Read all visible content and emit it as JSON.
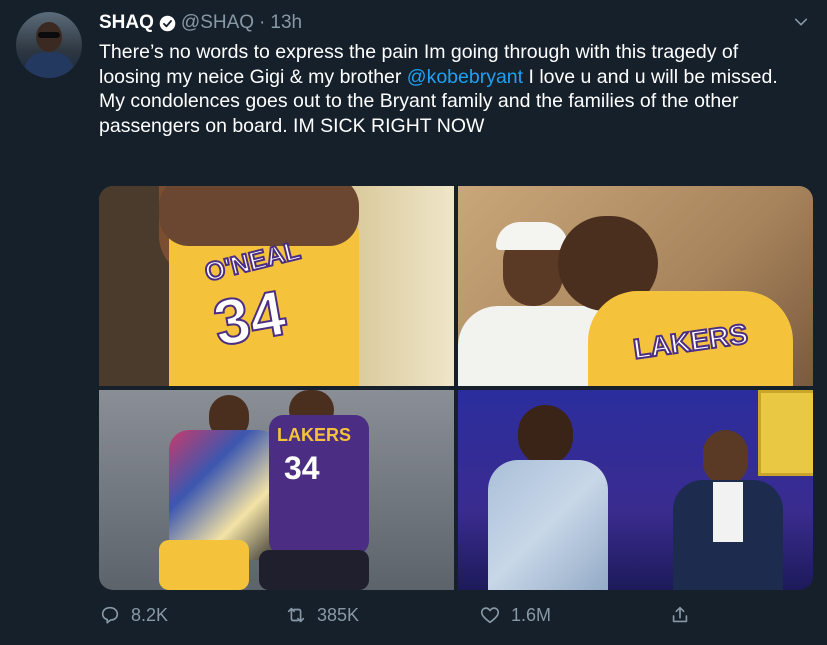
{
  "author": {
    "name": "SHAQ",
    "handle": "@SHAQ",
    "separator": "·",
    "time": "13h"
  },
  "tweet": {
    "text_before": "There’s no words to express the pain Im going through with this tragedy of loosing my neice Gigi & my brother ",
    "mention": "@kobebryant",
    "text_after": " I love u and u will be missed. My condolences goes out to the Bryant family and the families of the other passengers on board. IM SICK RIGHT NOW"
  },
  "media": {
    "photo1_jersey_name": "O'NEAL",
    "photo1_jersey_number": "34",
    "photo2_jersey_text": "LAKERS",
    "photo3_jersey_text": "LAKERS",
    "photo3_jersey_number": "34"
  },
  "actions": {
    "reply_count": "8.2K",
    "retweet_count": "385K",
    "like_count": "1.6M"
  },
  "colors": {
    "background": "#15202b",
    "secondary_text": "#8899a6",
    "link": "#1da1f2"
  }
}
